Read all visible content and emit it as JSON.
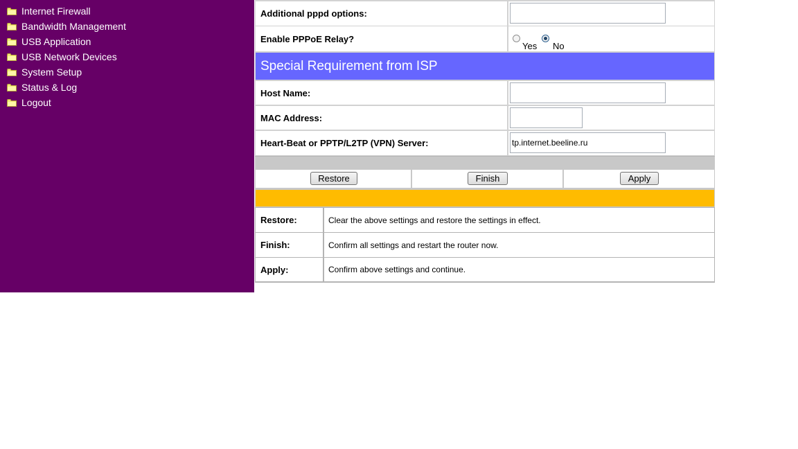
{
  "sidebar": {
    "items": [
      {
        "label": "Internet Firewall",
        "icon": "folder-icon"
      },
      {
        "label": "Bandwidth Management",
        "icon": "folder-icon"
      },
      {
        "label": "USB Application",
        "icon": "folder-icon"
      },
      {
        "label": "USB Network Devices",
        "icon": "folder-icon"
      },
      {
        "label": "System Setup",
        "icon": "folder-icon"
      },
      {
        "label": "Status & Log",
        "icon": "folder-icon"
      },
      {
        "label": "Logout",
        "icon": "folder-icon"
      }
    ]
  },
  "form": {
    "pppd_options": {
      "label": "Additional pppd options:",
      "value": ""
    },
    "pppoe_relay": {
      "label": "Enable PPPoE Relay?",
      "yes_label": "Yes",
      "no_label": "No",
      "selected": "No"
    },
    "isp_section_title": "Special Requirement from ISP",
    "host_name": {
      "label": "Host Name:",
      "value": ""
    },
    "mac_address": {
      "label": "MAC Address:",
      "value": ""
    },
    "vpn_server": {
      "label": "Heart-Beat or PPTP/L2TP (VPN) Server:",
      "value": "tp.internet.beeline.ru"
    }
  },
  "buttons": {
    "restore": "Restore",
    "finish": "Finish",
    "apply": "Apply"
  },
  "help": [
    {
      "term": "Restore:",
      "description": "Clear the above settings and restore the settings in effect."
    },
    {
      "term": "Finish:",
      "description": "Confirm all settings and restart the router now."
    },
    {
      "term": "Apply:",
      "description": "Confirm above settings and continue."
    }
  ],
  "colors": {
    "sidebar_bg": "#660066",
    "section_header_bg": "#6666FF",
    "help_header_bg": "#FFBB00",
    "divider_bg": "#C8C8C8"
  }
}
